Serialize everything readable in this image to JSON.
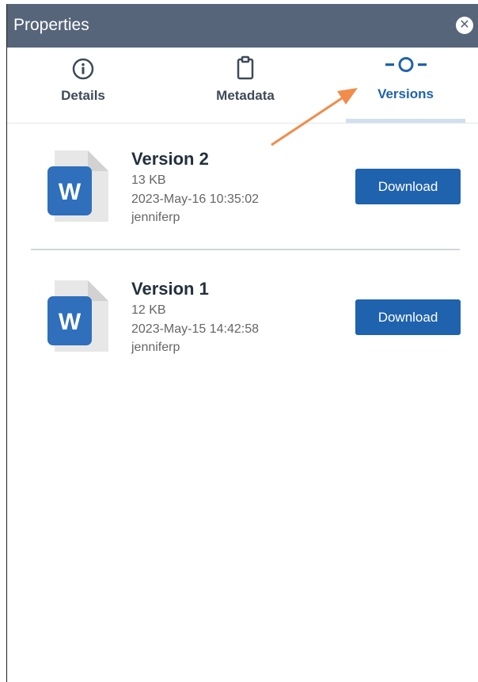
{
  "header": {
    "title": "Properties",
    "close_icon": "close-circle-icon"
  },
  "tabs": [
    {
      "label": "Details",
      "icon": "info-icon",
      "active": false
    },
    {
      "label": "Metadata",
      "icon": "clipboard-icon",
      "active": false
    },
    {
      "label": "Versions",
      "icon": "versions-icon",
      "active": true
    }
  ],
  "versions": [
    {
      "title": "Version 2",
      "size": "13 KB",
      "date": "2023-May-16 10:35:02",
      "user": "jenniferp",
      "download_label": "Download"
    },
    {
      "title": "Version 1",
      "size": "12 KB",
      "date": "2023-May-15 14:42:58",
      "user": "jenniferp",
      "download_label": "Download"
    }
  ],
  "colors": {
    "header_bg": "#566579",
    "accent": "#1f62ad",
    "annotation_arrow": "#f28c4b"
  }
}
